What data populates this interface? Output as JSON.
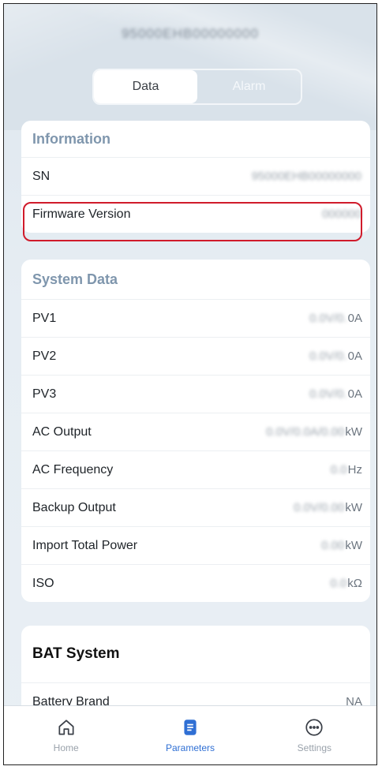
{
  "header": {
    "device_sn": "95000EHB00000000",
    "tabs": [
      {
        "label": "Data",
        "active": true
      },
      {
        "label": "Alarm",
        "active": false
      }
    ]
  },
  "information": {
    "title": "Information",
    "rows": [
      {
        "label": "SN",
        "value": "95000EHB00000000"
      },
      {
        "label": "Firmware Version",
        "value": "000000"
      }
    ]
  },
  "system_data": {
    "title": "System Data",
    "rows": [
      {
        "label": "PV1",
        "value": "0.0V/0.",
        "unit": "0A"
      },
      {
        "label": "PV2",
        "value": "0.0V/0.",
        "unit": "0A"
      },
      {
        "label": "PV3",
        "value": "0.0V/0.",
        "unit": "0A"
      },
      {
        "label": "AC Output",
        "value": "0.0V/0.0A/0.00",
        "unit": "kW"
      },
      {
        "label": "AC Frequency",
        "value": "0.0",
        "unit": "Hz"
      },
      {
        "label": "Backup Output",
        "value": "0.0V/0.00",
        "unit": "kW"
      },
      {
        "label": "Import Total Power",
        "value": "0.00",
        "unit": "kW"
      },
      {
        "label": "ISO",
        "value": "0.0",
        "unit": "kΩ"
      }
    ]
  },
  "bat_system": {
    "title": "BAT System",
    "rows": [
      {
        "label": "Battery Brand",
        "value": "NA"
      }
    ]
  },
  "tabbar": {
    "items": [
      {
        "label": "Home",
        "icon": "home-icon",
        "active": false
      },
      {
        "label": "Parameters",
        "icon": "parameters-icon",
        "active": true
      },
      {
        "label": "Settings",
        "icon": "settings-icon",
        "active": false
      }
    ]
  },
  "colors": {
    "accent": "#2f6fd4",
    "highlight": "#d01b2b",
    "section_title": "#7f96ad"
  }
}
